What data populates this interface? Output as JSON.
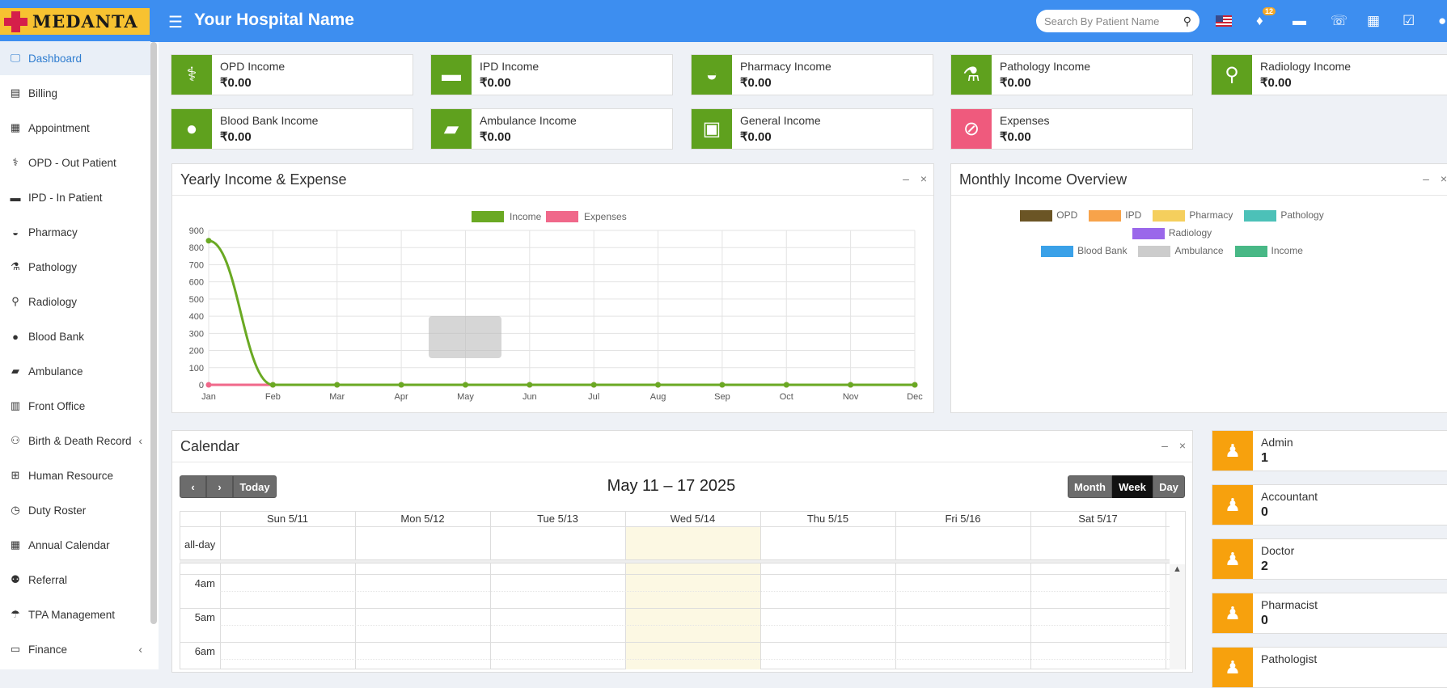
{
  "brand": {
    "logo_text": "MEDANTA",
    "hospital_name": "Your Hospital Name"
  },
  "search": {
    "placeholder": "Search By Patient Name"
  },
  "notifications": {
    "count": "12"
  },
  "sidebar": {
    "items": [
      {
        "label": "Dashboard",
        "icon": "monitor-icon",
        "glyph": "🖵",
        "active": true
      },
      {
        "label": "Billing",
        "icon": "billing-icon",
        "glyph": "▤"
      },
      {
        "label": "Appointment",
        "icon": "calendar-check-icon",
        "glyph": "▦"
      },
      {
        "label": "OPD - Out Patient",
        "icon": "stethoscope-icon",
        "glyph": "⚕"
      },
      {
        "label": "IPD - In Patient",
        "icon": "bed-icon",
        "glyph": "▬"
      },
      {
        "label": "Pharmacy",
        "icon": "mortar-pestle-icon",
        "glyph": "◒"
      },
      {
        "label": "Pathology",
        "icon": "flask-icon",
        "glyph": "⚗"
      },
      {
        "label": "Radiology",
        "icon": "microscope-icon",
        "glyph": "⚲"
      },
      {
        "label": "Blood Bank",
        "icon": "droplet-icon",
        "glyph": "●"
      },
      {
        "label": "Ambulance",
        "icon": "ambulance-icon",
        "glyph": "▰"
      },
      {
        "label": "Front Office",
        "icon": "building-icon",
        "glyph": "▥"
      },
      {
        "label": "Birth & Death Record",
        "icon": "family-icon",
        "glyph": "⚇",
        "chevron": "‹"
      },
      {
        "label": "Human Resource",
        "icon": "sitemap-icon",
        "glyph": "⊞"
      },
      {
        "label": "Duty Roster",
        "icon": "clock-icon",
        "glyph": "◷"
      },
      {
        "label": "Annual Calendar",
        "icon": "calculator-icon",
        "glyph": "▦"
      },
      {
        "label": "Referral",
        "icon": "users-icon",
        "glyph": "⚉"
      },
      {
        "label": "TPA Management",
        "icon": "umbrella-icon",
        "glyph": "☂"
      },
      {
        "label": "Finance",
        "icon": "finance-icon",
        "glyph": "▭",
        "chevron": "‹"
      }
    ]
  },
  "income_cards": [
    {
      "label": "OPD Income",
      "value": "₹0.00",
      "icon": "stethoscope-icon",
      "glyph": "⚕",
      "color": "#5fa11e"
    },
    {
      "label": "IPD Income",
      "value": "₹0.00",
      "icon": "bed-icon",
      "glyph": "▬",
      "color": "#5fa11e"
    },
    {
      "label": "Pharmacy Income",
      "value": "₹0.00",
      "icon": "mortar-pestle-icon",
      "glyph": "◒",
      "color": "#5fa11e"
    },
    {
      "label": "Pathology Income",
      "value": "₹0.00",
      "icon": "flask-icon",
      "glyph": "⚗",
      "color": "#5fa11e"
    },
    {
      "label": "Radiology Income",
      "value": "₹0.00",
      "icon": "microscope-icon",
      "glyph": "⚲",
      "color": "#5fa11e"
    },
    {
      "label": "Blood Bank Income",
      "value": "₹0.00",
      "icon": "droplet-icon",
      "glyph": "●",
      "color": "#5fa11e"
    },
    {
      "label": "Ambulance Income",
      "value": "₹0.00",
      "icon": "ambulance-icon",
      "glyph": "▰",
      "color": "#5fa11e"
    },
    {
      "label": "General Income",
      "value": "₹0.00",
      "icon": "money-icon",
      "glyph": "▣",
      "color": "#5fa11e"
    },
    {
      "label": "Expenses",
      "value": "₹0.00",
      "icon": "expense-icon",
      "glyph": "⊘",
      "color": "#ef5a7d"
    }
  ],
  "yearly_panel": {
    "title": "Yearly Income & Expense"
  },
  "monthly_panel": {
    "title": "Monthly Income Overview",
    "legend": [
      {
        "name": "OPD",
        "color": "#6b5525"
      },
      {
        "name": "IPD",
        "color": "#f7a34a"
      },
      {
        "name": "Pharmacy",
        "color": "#f5cf5d"
      },
      {
        "name": "Pathology",
        "color": "#4cc1b8"
      },
      {
        "name": "Radiology",
        "color": "#9a67ea"
      },
      {
        "name": "Blood Bank",
        "color": "#3aa1e8"
      },
      {
        "name": "Ambulance",
        "color": "#cccccc"
      },
      {
        "name": "Income",
        "color": "#48b886"
      }
    ]
  },
  "chart_data": {
    "type": "line",
    "title": "",
    "x": [
      "Jan",
      "Feb",
      "Mar",
      "Apr",
      "May",
      "Jun",
      "Jul",
      "Aug",
      "Sep",
      "Oct",
      "Nov",
      "Dec"
    ],
    "ylim": [
      0,
      900
    ],
    "yticks": [
      0,
      100,
      200,
      300,
      400,
      500,
      600,
      700,
      800,
      900
    ],
    "grid": true,
    "legend_position": "top",
    "series": [
      {
        "name": "Income",
        "color": "#6aa923",
        "values": [
          840,
          0,
          0,
          0,
          0,
          0,
          0,
          0,
          0,
          0,
          0,
          0
        ]
      },
      {
        "name": "Expenses",
        "color": "#f0688a",
        "values": [
          0,
          0,
          0,
          0,
          0,
          0,
          0,
          0,
          0,
          0,
          0,
          0
        ]
      }
    ]
  },
  "calendar": {
    "title": "Calendar",
    "range_title": "May 11 – 17 2025",
    "prev": "‹",
    "next": "›",
    "today_label": "Today",
    "views": [
      "Month",
      "Week",
      "Day"
    ],
    "active_view": "Week",
    "days": [
      "Sun 5/11",
      "Mon 5/12",
      "Tue 5/13",
      "Wed 5/14",
      "Thu 5/15",
      "Fri 5/16",
      "Sat 5/17"
    ],
    "today_index": 3,
    "allday_label": "all-day",
    "hours": [
      "4am",
      "5am",
      "6am"
    ]
  },
  "staff_cards": [
    {
      "label": "Admin",
      "value": "1"
    },
    {
      "label": "Accountant",
      "value": "0"
    },
    {
      "label": "Doctor",
      "value": "2"
    },
    {
      "label": "Pharmacist",
      "value": "0"
    },
    {
      "label": "Pathologist",
      "value": ""
    }
  ],
  "panel_tools": {
    "minimize": "–",
    "close": "×"
  }
}
